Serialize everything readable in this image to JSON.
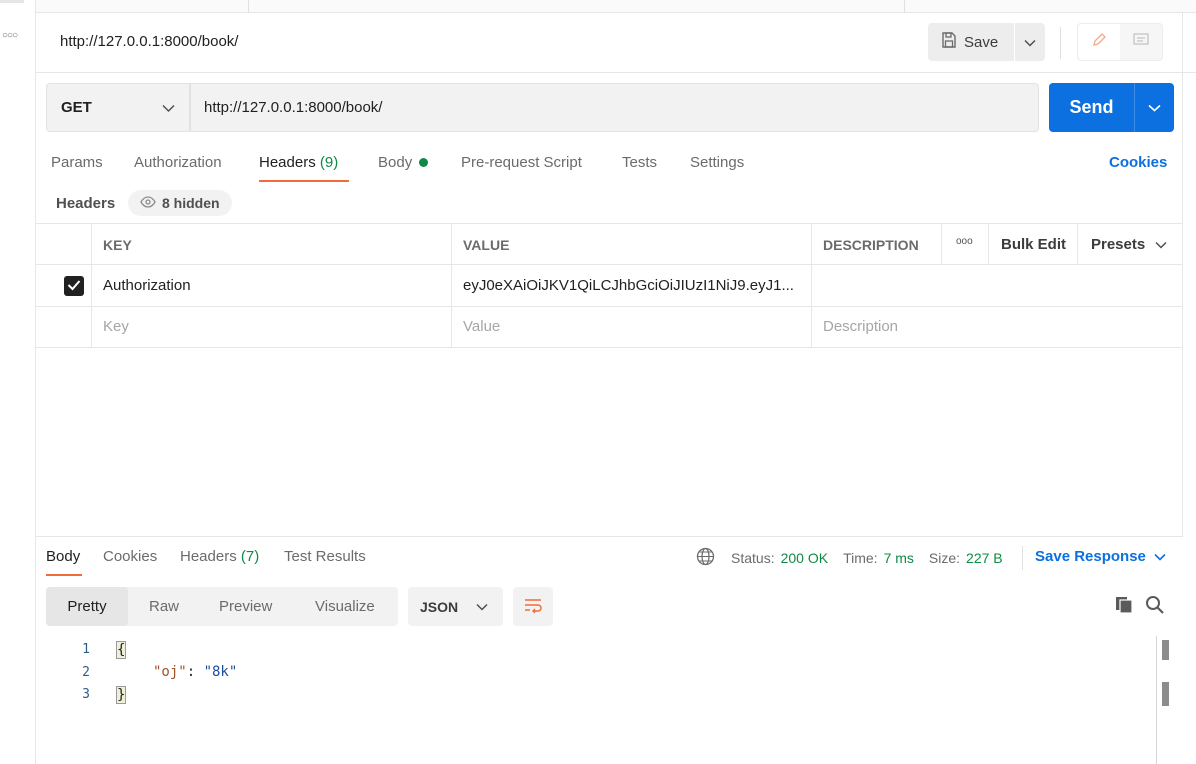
{
  "request": {
    "title": "http://127.0.0.1:8000/book/",
    "method": "GET",
    "url": "http://127.0.0.1:8000/book/"
  },
  "toolbar": {
    "save_label": "Save",
    "send_label": "Send"
  },
  "request_tabs": [
    {
      "label": "Params"
    },
    {
      "label": "Authorization"
    },
    {
      "label": "Headers",
      "count": "(9)"
    },
    {
      "label": "Body"
    },
    {
      "label": "Pre-request Script"
    },
    {
      "label": "Tests"
    },
    {
      "label": "Settings"
    }
  ],
  "active_request_tab": "Headers",
  "cookies_link": "Cookies",
  "headers_section": {
    "label": "Headers",
    "hidden_label": "8 hidden",
    "columns": {
      "key": "KEY",
      "value": "VALUE",
      "description": "DESCRIPTION",
      "more": "ooo",
      "bulk_edit": "Bulk Edit",
      "presets": "Presets"
    },
    "rows": [
      {
        "checked": true,
        "key": "Authorization",
        "value": "eyJ0eXAiOiJKV1QiLCJhbGciOiJIUzI1NiJ9.eyJ1...",
        "description": ""
      }
    ],
    "placeholders": {
      "key": "Key",
      "value": "Value",
      "description": "Description"
    }
  },
  "response": {
    "tabs": [
      {
        "label": "Body"
      },
      {
        "label": "Cookies"
      },
      {
        "label": "Headers",
        "count": "(7)"
      },
      {
        "label": "Test Results"
      }
    ],
    "active_tab": "Body",
    "status_label": "Status:",
    "status_value": "200 OK",
    "time_label": "Time:",
    "time_value": "7 ms",
    "size_label": "Size:",
    "size_value": "227 B",
    "save_response": "Save Response",
    "view_modes": [
      "Pretty",
      "Raw",
      "Preview",
      "Visualize"
    ],
    "active_view_mode": "Pretty",
    "format": "JSON",
    "body_lines": [
      {
        "num": "1",
        "open": "{"
      },
      {
        "num": "2",
        "key": "\"oj\"",
        "sep": ": ",
        "value": "\"8k\""
      },
      {
        "num": "3",
        "close": "}"
      }
    ]
  },
  "colors": {
    "accent": "#0c70e0",
    "tab_underline": "#f26b3a",
    "success": "#0f8a44"
  },
  "icons": [
    "more-icon",
    "save-icon",
    "chevron-down-icon",
    "edit-icon",
    "comment-icon",
    "eye-icon",
    "checkmark-icon",
    "globe-icon",
    "wrap-lines-icon",
    "copy-icon",
    "search-icon"
  ]
}
